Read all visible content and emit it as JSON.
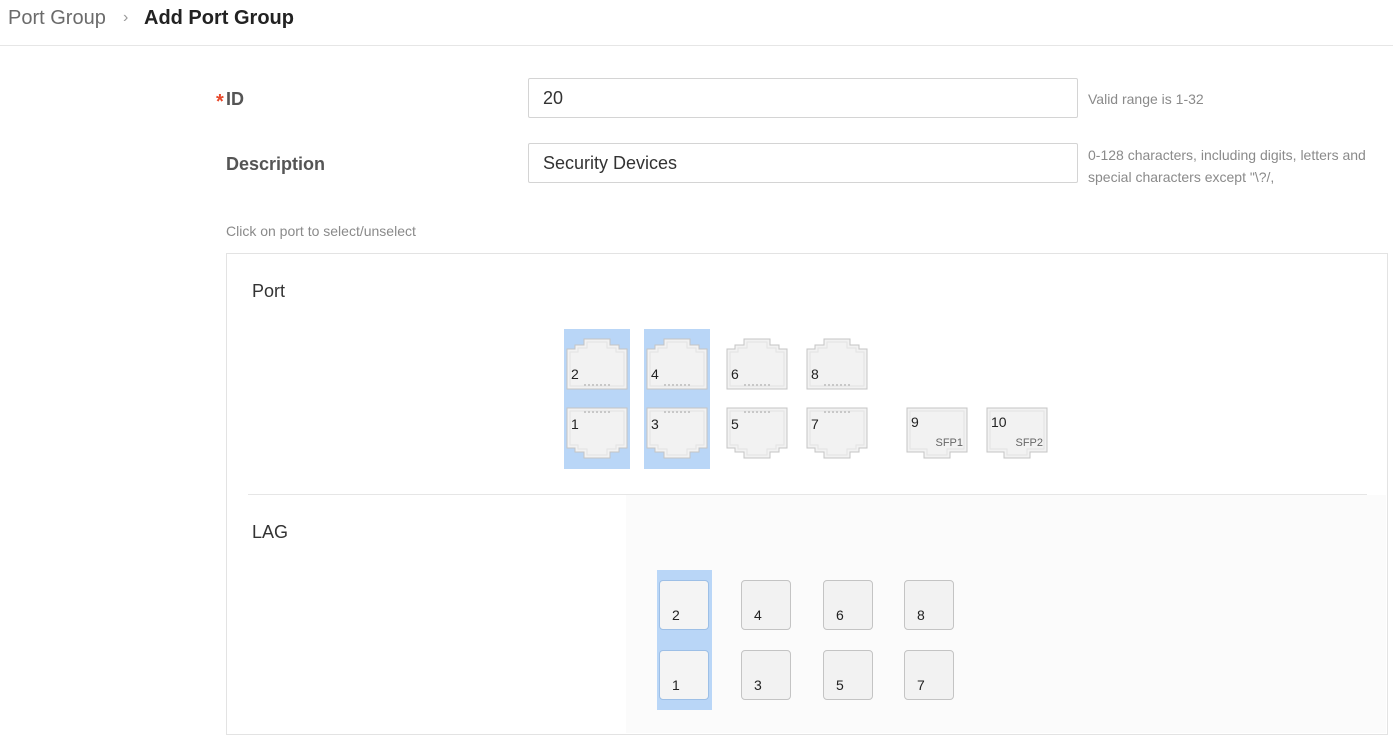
{
  "breadcrumb": {
    "root": "Port Group",
    "separator": "›",
    "current": "Add Port Group"
  },
  "form": {
    "id": {
      "required_mark": "*",
      "label": "ID",
      "value": "20",
      "hint": "Valid range is 1-32"
    },
    "description": {
      "label": "Description",
      "value": "Security Devices",
      "hint": "0-128 characters, including digits, letters and special characters except \"\\?/,"
    },
    "click_hint": "Click on port to select/unselect"
  },
  "port_section": {
    "title": "Port",
    "ports": [
      {
        "num": "2",
        "selected": true
      },
      {
        "num": "4",
        "selected": true
      },
      {
        "num": "6",
        "selected": false
      },
      {
        "num": "8",
        "selected": false
      },
      {
        "num": "1",
        "selected": true
      },
      {
        "num": "3",
        "selected": true
      },
      {
        "num": "5",
        "selected": false
      },
      {
        "num": "7",
        "selected": false
      },
      {
        "num": "9",
        "sub": "SFP1",
        "selected": false
      },
      {
        "num": "10",
        "sub": "SFP2",
        "selected": false
      }
    ]
  },
  "lag_section": {
    "title": "LAG",
    "lags": [
      {
        "num": "2",
        "selected": true
      },
      {
        "num": "4",
        "selected": false
      },
      {
        "num": "6",
        "selected": false
      },
      {
        "num": "8",
        "selected": false
      },
      {
        "num": "1",
        "selected": true
      },
      {
        "num": "3",
        "selected": false
      },
      {
        "num": "5",
        "selected": false
      },
      {
        "num": "7",
        "selected": false
      }
    ]
  },
  "colors": {
    "required": "#e8492b",
    "selected": "#b9d6f7",
    "border": "#e3e3e3"
  }
}
